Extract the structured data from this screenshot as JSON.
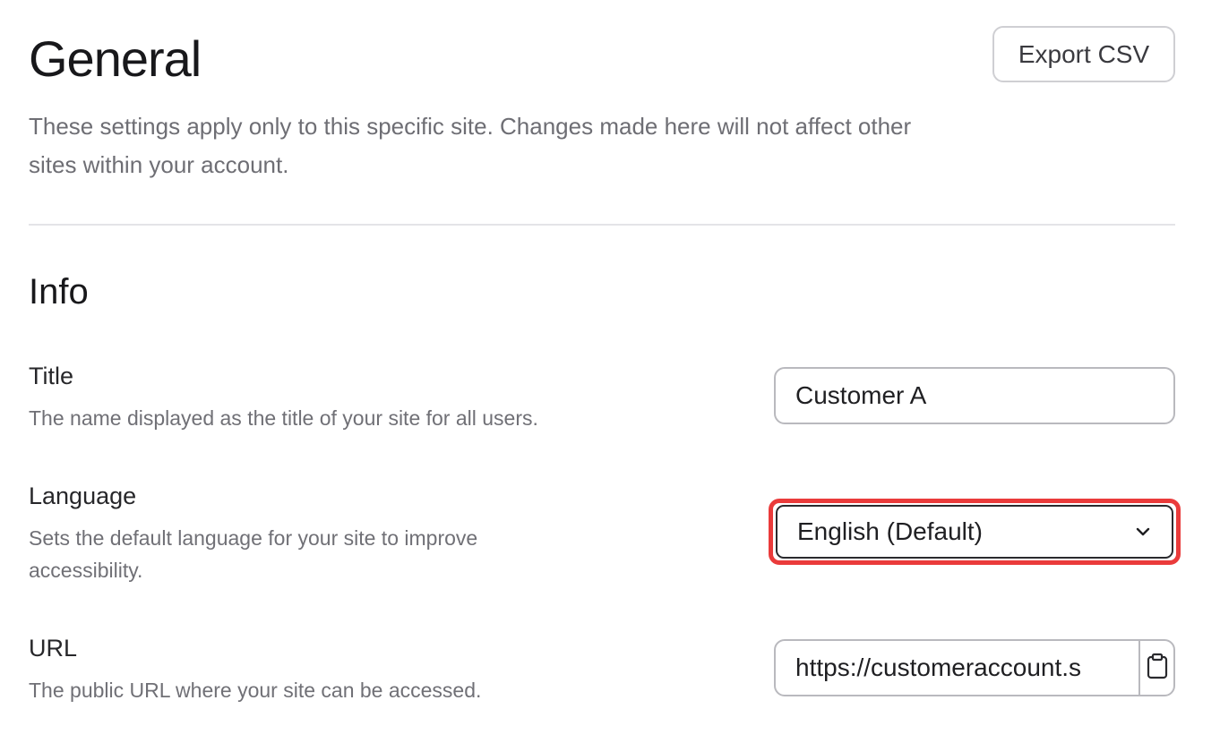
{
  "header": {
    "title": "General",
    "export_label": "Export CSV",
    "description": "These settings apply only to this specific site. Changes made here will not affect other sites within your account."
  },
  "info": {
    "section_title": "Info",
    "title_field": {
      "label": "Title",
      "help": "The name displayed as the title of your site for all users.",
      "value": "Customer A"
    },
    "language_field": {
      "label": "Language",
      "help": "Sets the default language for your site to improve accessibility.",
      "selected": "English (Default)",
      "highlight_color": "#ea3b3b"
    },
    "url_field": {
      "label": "URL",
      "help": "The public URL where your site can be accessed.",
      "value": "https://customeraccount.s"
    }
  },
  "icons": {
    "select": "chevron-down-icon",
    "copy": "clipboard-icon"
  }
}
